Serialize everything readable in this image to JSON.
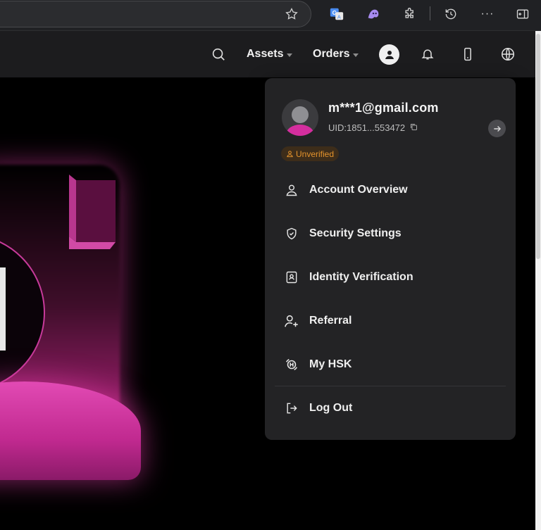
{
  "browser": {
    "icons": [
      "star-icon",
      "google-translate-icon",
      "ghost-extension-icon",
      "extensions-puzzle-icon",
      "history-icon",
      "more-icon",
      "sidebar-icon"
    ],
    "more_label": "···"
  },
  "header": {
    "nav": [
      {
        "label": "Assets"
      },
      {
        "label": "Orders"
      }
    ],
    "icons": [
      "search-icon",
      "user-icon",
      "bell-icon",
      "mobile-icon",
      "globe-icon"
    ]
  },
  "account": {
    "email": "m***1@gmail.com",
    "uid": "UID:1851...553472",
    "status": "Unverified"
  },
  "menu": {
    "items": [
      {
        "label": "Account Overview",
        "icon": "user-outline-icon"
      },
      {
        "label": "Security Settings",
        "icon": "shield-check-icon"
      },
      {
        "label": "Identity Verification",
        "icon": "id-card-icon"
      },
      {
        "label": "Referral",
        "icon": "user-plus-icon"
      },
      {
        "label": "My HSK",
        "icon": "hsk-coin-icon"
      }
    ],
    "logout": {
      "label": "Log Out",
      "icon": "logout-icon"
    }
  },
  "colors": {
    "accent": "#d42e9e",
    "warning": "#e4932c",
    "panel": "#232325",
    "header": "#1c1c1e"
  }
}
